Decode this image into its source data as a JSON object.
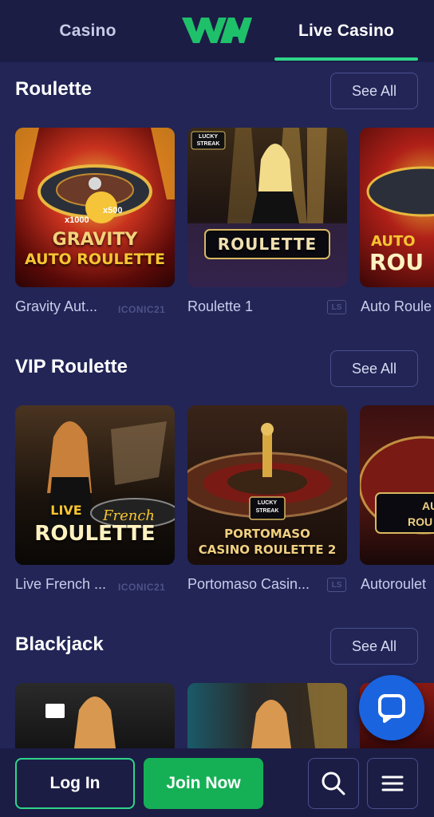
{
  "header": {
    "tabs": [
      {
        "label": "Casino",
        "active": false
      },
      {
        "label": "Live Casino",
        "active": true
      }
    ],
    "logo_icon": "wm-logo",
    "accent_color": "#2fd58a"
  },
  "sections": [
    {
      "title": "Roulette",
      "see_all_label": "See All",
      "cards": [
        {
          "label": "Gravity Aut...",
          "art_text_1": "GRAVITY",
          "art_text_2": "AUTO ROULETTE",
          "art_badge_1": "x1000",
          "art_badge_2": "x500",
          "provider": "ICONIC21"
        },
        {
          "label": "Roulette 1",
          "art_text_1": "ROULETTE",
          "art_badge_1": "LUCKY STREAK",
          "provider": "LS"
        },
        {
          "label": "Auto Roule",
          "art_text_1": "AUTO",
          "art_text_2": "ROU"
        }
      ]
    },
    {
      "title": "VIP Roulette",
      "see_all_label": "See All",
      "cards": [
        {
          "label": "Live French ...",
          "art_text_1": "LIVE",
          "art_text_2": "ROULETTE",
          "art_text_3": "French",
          "provider": "ICONIC21"
        },
        {
          "label": "Portomaso Casin...",
          "art_text_1": "PORTOMASO",
          "art_text_2": "CASINO ROULETTE 2",
          "art_badge_1": "LUCKY STREAK",
          "provider": "LS"
        },
        {
          "label": "Autoroulet",
          "art_text_1": "AU",
          "art_text_2": "ROU"
        }
      ]
    },
    {
      "title": "Blackjack",
      "see_all_label": "See All",
      "cards": [
        {
          "label": ""
        },
        {
          "label": ""
        },
        {
          "label": ""
        }
      ]
    }
  ],
  "bottom_bar": {
    "login_label": "Log In",
    "join_label": "Join Now",
    "search_icon": "search-icon",
    "menu_icon": "menu-icon"
  },
  "chat": {
    "icon": "chat-bubble-icon"
  }
}
